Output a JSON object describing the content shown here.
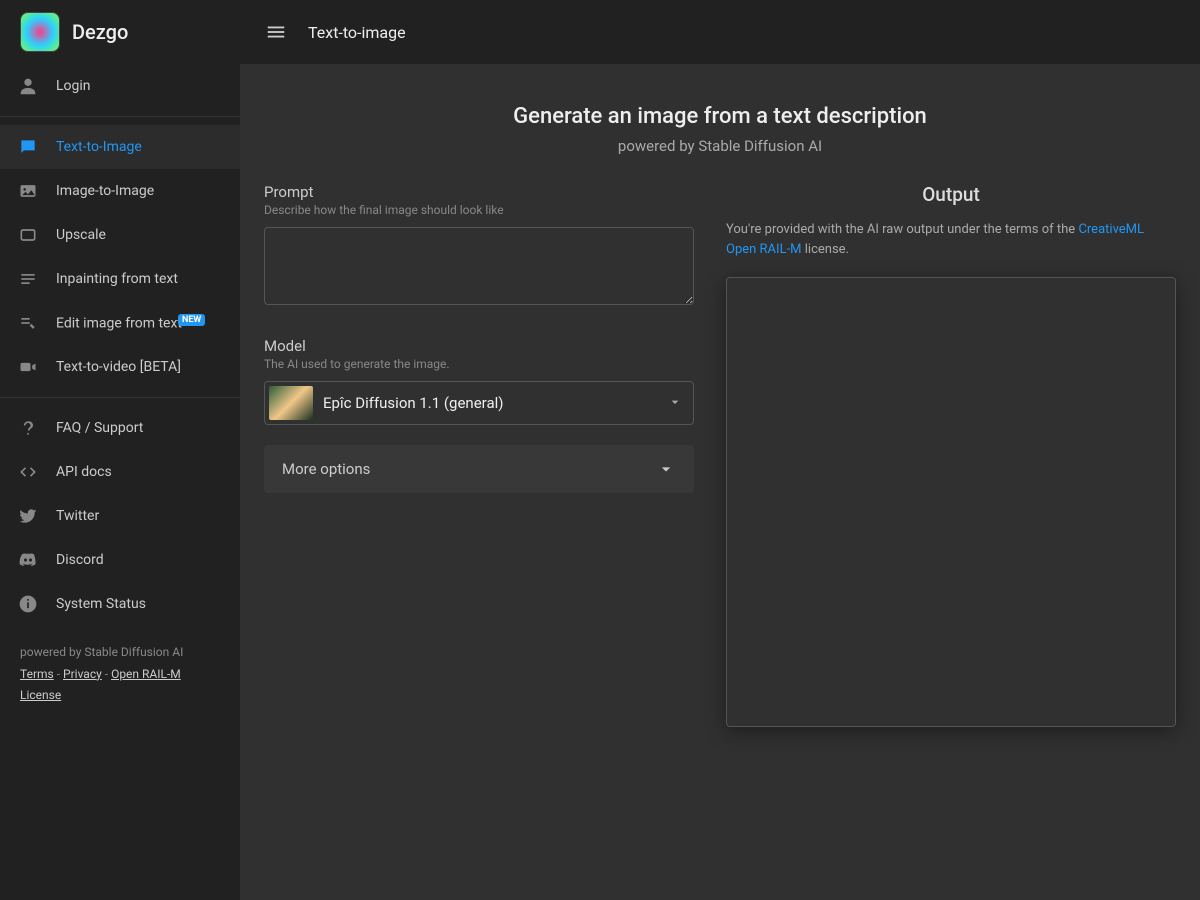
{
  "brand": {
    "name": "Dezgo"
  },
  "login": {
    "label": "Login"
  },
  "nav": {
    "items": [
      {
        "label": "Text-to-Image",
        "icon": "chat-icon",
        "active": true
      },
      {
        "label": "Image-to-Image",
        "icon": "image-icon",
        "active": false
      },
      {
        "label": "Upscale",
        "icon": "aspect-icon",
        "active": false
      },
      {
        "label": "Inpainting from text",
        "icon": "list-icon",
        "active": false
      },
      {
        "label": "Edit image from text",
        "icon": "edit-icon",
        "active": false,
        "badge": "NEW"
      },
      {
        "label": "Text-to-video [BETA]",
        "icon": "video-icon",
        "active": false
      }
    ],
    "secondary": [
      {
        "label": "FAQ / Support",
        "icon": "help-icon"
      },
      {
        "label": "API docs",
        "icon": "code-icon"
      },
      {
        "label": "Twitter",
        "icon": "twitter-icon"
      },
      {
        "label": "Discord",
        "icon": "discord-icon"
      },
      {
        "label": "System Status",
        "icon": "info-icon"
      }
    ]
  },
  "footer": {
    "powered": "powered by Stable Diffusion AI",
    "terms": "Terms",
    "privacy": "Privacy",
    "license": "Open RAIL-M License",
    "sep": " - "
  },
  "topbar": {
    "title": "Text-to-image"
  },
  "page": {
    "heading": "Generate an image from a text description",
    "sub": "powered by Stable Diffusion AI"
  },
  "prompt": {
    "label": "Prompt",
    "hint": "Describe how the final image should look like",
    "value": ""
  },
  "model": {
    "label": "Model",
    "hint": "The AI used to generate the image.",
    "selected": "Epîc Diffusion 1.1 (general)"
  },
  "more": {
    "label": "More options"
  },
  "output": {
    "heading": "Output",
    "note_prefix": "You're provided with the AI raw output under the terms of the ",
    "note_link": "CreativeML Open RAIL-M",
    "note_suffix": " license."
  }
}
